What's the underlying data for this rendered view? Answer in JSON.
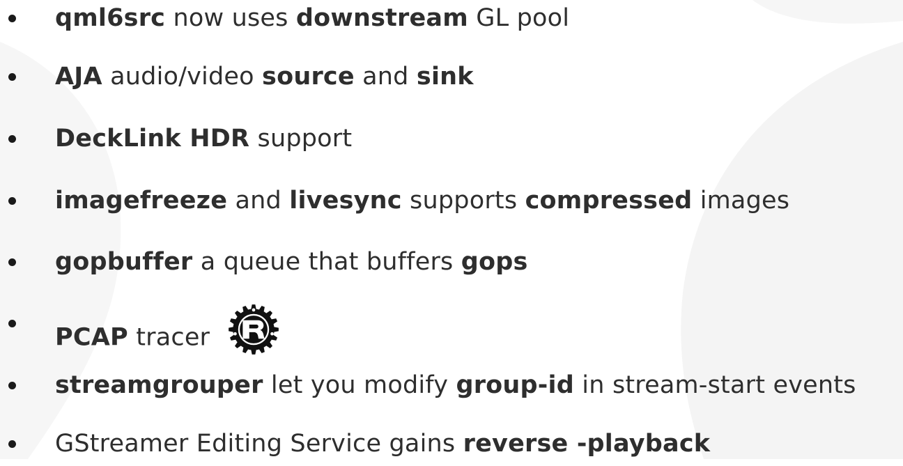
{
  "slide": {
    "bullets": [
      {
        "parts": [
          {
            "text": "qml6src",
            "bold": true
          },
          {
            "text": " now uses ",
            "bold": false
          },
          {
            "text": "downstream",
            "bold": true
          },
          {
            "text": " GL pool",
            "bold": false
          }
        ]
      },
      {
        "parts": [
          {
            "text": "AJA",
            "bold": true
          },
          {
            "text": " audio/video ",
            "bold": false
          },
          {
            "text": "source",
            "bold": true
          },
          {
            "text": " and ",
            "bold": false
          },
          {
            "text": "sink",
            "bold": true
          }
        ]
      },
      {
        "parts": [
          {
            "text": "DeckLink HDR",
            "bold": true
          },
          {
            "text": " support",
            "bold": false
          }
        ]
      },
      {
        "parts": [
          {
            "text": "imagefreeze",
            "bold": true
          },
          {
            "text": " and ",
            "bold": false
          },
          {
            "text": "livesync",
            "bold": true
          },
          {
            "text": " supports ",
            "bold": false
          },
          {
            "text": "compressed",
            "bold": true
          },
          {
            "text": " images",
            "bold": false
          }
        ]
      },
      {
        "parts": [
          {
            "text": "gopbuffer",
            "bold": true
          },
          {
            "text": " a queue that buffers ",
            "bold": false
          },
          {
            "text": "gops",
            "bold": true
          }
        ]
      },
      {
        "parts": [
          {
            "text": "PCAP",
            "bold": true
          },
          {
            "text": " tracer",
            "bold": false
          }
        ],
        "icon": "rust-logo-icon"
      },
      {
        "parts": [
          {
            "text": "streamgrouper",
            "bold": true
          },
          {
            "text": " let you modify ",
            "bold": false
          },
          {
            "text": "group-id",
            "bold": true
          },
          {
            "text": " in stream-start events",
            "bold": false
          }
        ]
      },
      {
        "parts": [
          {
            "text": "GStreamer Editing Service gains ",
            "bold": false
          },
          {
            "text": "reverse -playback",
            "bold": true
          }
        ]
      }
    ]
  },
  "colors": {
    "text": "#2e2e2e",
    "bullet": "#1a1a1a",
    "background": "#ffffff",
    "watermark": "#f3f3f3"
  }
}
